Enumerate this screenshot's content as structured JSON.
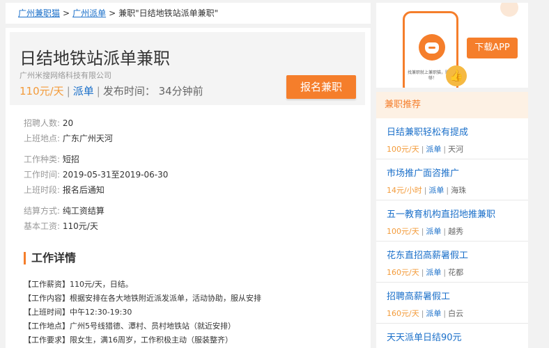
{
  "breadcrumb": {
    "items": [
      "广州兼职猫",
      "广州派单"
    ],
    "current": "兼职\"日结地铁站派单兼职\"",
    "separator": ">"
  },
  "job": {
    "title": "日结地铁站派单兼职",
    "company": "广州米搜网络科技有限公司",
    "salary": "110元/天",
    "type": "派单",
    "posted": "发布时间： 34分钟前",
    "apply_label": "报名兼职"
  },
  "info": [
    {
      "key": "招聘人数:",
      "value": "20"
    },
    {
      "key": "上班地点:",
      "value": "广东广州天河"
    },
    {
      "key": "工作种类:",
      "value": "短招"
    },
    {
      "key": "工作时间:",
      "value": "2019-05-31至2019-06-30"
    },
    {
      "key": "上班时段:",
      "value": "报名后通知"
    },
    {
      "key": "结算方式:",
      "value": "纯工资结算"
    },
    {
      "key": "基本工资:",
      "value": "110元/天"
    }
  ],
  "details": {
    "title": "工作详情",
    "lines": [
      "【工作薪资】110元/天，日结。",
      "【工作内容】根据安排在各大地铁附近派发派单，活动协助，服从安排",
      "【上班时间】中午12:30-19:30",
      "【工作地点】广州5号线猎德、潭村、员村地铁站（就近安排）",
      "【工作要求】限女生，满16周岁，工作积极主动（服装整齐）"
    ]
  },
  "ad": {
    "tagline": "找兼职就上兼职猫，赚了个够！",
    "download_label": "下载APP",
    "thumb_icon": "👍"
  },
  "recommend": {
    "title": "兼职推荐",
    "items": [
      {
        "title": "日结兼职轻松有提成",
        "salary": "100元/天",
        "type": "派单",
        "area": "天河"
      },
      {
        "title": "市场推广面咨推广",
        "salary": "14元/小时",
        "type": "派单",
        "area": "海珠"
      },
      {
        "title": "五一教育机构直招地推兼职",
        "salary": "100元/天",
        "type": "派单",
        "area": "越秀"
      },
      {
        "title": "花东直招高薪暑假工",
        "salary": "160元/天",
        "type": "派单",
        "area": "花都"
      },
      {
        "title": "招聘高薪暑假工",
        "salary": "160元/天",
        "type": "派单",
        "area": "白云"
      },
      {
        "title": "天天派单日结90元",
        "salary": "",
        "type": "",
        "area": ""
      }
    ]
  },
  "colors": {
    "accent": "#f57e2b",
    "link": "#1a6fc9",
    "salary": "#f39b3a"
  }
}
